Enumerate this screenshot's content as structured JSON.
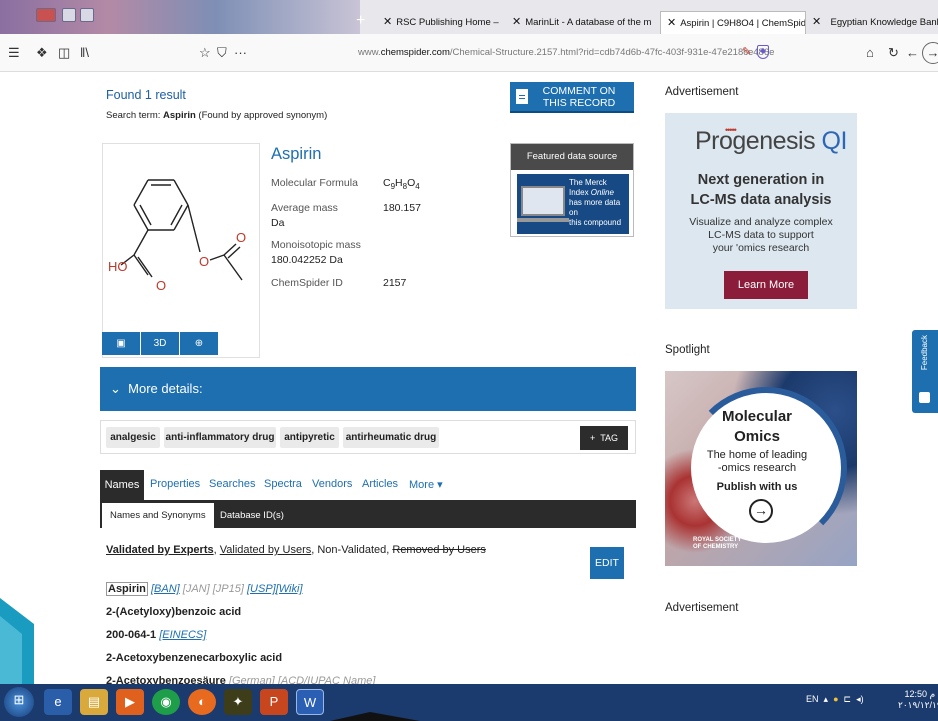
{
  "browser": {
    "tabs": [
      {
        "label": "RSC Publishing Home – Chem"
      },
      {
        "label": "MarinLit - A database of the m"
      },
      {
        "label": "Aspirin | C9H8O4 | ChemSpider"
      },
      {
        "label": "Egyptian Knowledge Bank"
      }
    ],
    "url_prefix": "www.",
    "url_domain": "chemspider.com",
    "url_rest": "/Chemical-Structure.2157.html?rid=cdb74d6b-47fc-403f-931e-47e218ce486e",
    "menu_icon": "☰",
    "more_icon": "···"
  },
  "results": {
    "found_text": "Found 1 result",
    "search_term_label": "Search term: ",
    "search_term_value": "Aspirin",
    "search_term_note": " (Found by approved synonym)"
  },
  "comment_button": {
    "line1": "COMMENT ON",
    "line2": "THIS RECORD"
  },
  "structure": {
    "atom_ho": "HO",
    "atom_o": "O",
    "btn_3d": "3D"
  },
  "compound": {
    "name": "Aspirin",
    "formula_label": "Molecular Formula",
    "formula_value": "C9H8O4",
    "avg_mass_label": "Average mass",
    "avg_mass_unit": "Da",
    "avg_mass_value": "180.157",
    "mono_mass_label": "Monoisotopic mass",
    "mono_mass_value": "180.042252 Da",
    "csid_label": "ChemSpider ID",
    "csid_value": "2157"
  },
  "featured": {
    "header": "Featured data source",
    "line1": "The Merck",
    "line2a": "Index ",
    "line2b": "Online",
    "line3": "has more data on",
    "line4": "this compound"
  },
  "more_details": {
    "label": "More details:",
    "chevron": "⌄"
  },
  "tags": [
    "analgesic",
    "anti-inflammatory drug",
    "antipyretic",
    "antirheumatic drug"
  ],
  "tag_button": {
    "plus": "+",
    "label": "TAG"
  },
  "tabs": [
    "Names",
    "Properties",
    "Searches",
    "Spectra",
    "Vendors",
    "Articles",
    "More"
  ],
  "more_caret": "▾",
  "subtabs": [
    "Names and Synonyms",
    "Database ID(s)"
  ],
  "validation": {
    "experts": "Validated by Experts",
    "sep1": ", ",
    "users": "Validated by Users",
    "sep2": ", Non-Validated, ",
    "removed": "Removed by Users"
  },
  "edit_button": "EDIT",
  "synonyms": [
    {
      "name": "Aspirin",
      "refs": [
        {
          "t": "[BAN]",
          "style": "ref"
        },
        {
          "t": "[JAN]",
          "style": "grey"
        },
        {
          "t": "[JP15]",
          "style": "grey"
        },
        {
          "t": "[USP]",
          "style": "ref"
        },
        {
          "t": "[Wiki]",
          "style": "ref"
        }
      ]
    },
    {
      "name": "2-(Acetyloxy)benzoic acid",
      "refs": []
    },
    {
      "name": "200-064-1",
      "refs": [
        {
          "t": "[EINECS]",
          "style": "ref"
        }
      ]
    },
    {
      "name": "2-Acetoxybenzenecarboxylic acid",
      "refs": []
    },
    {
      "name": "2-Acetoxybenzoesäure",
      "refs": [
        {
          "t": "[German]",
          "style": "grey"
        },
        {
          "t": "[ACD/IUPAC Name]",
          "style": "grey"
        }
      ]
    }
  ],
  "ads": {
    "advertisement_label": "Advertisement",
    "progenesis": {
      "logo_main": "Progenesis",
      "logo_qi": "QI",
      "dots": "•••••",
      "headline1": "Next generation in",
      "headline2": "LC-MS data analysis",
      "sub1": "Visualize and analyze complex",
      "sub2": "LC-MS data to support",
      "sub3": "your 'omics research",
      "button": "Learn More"
    },
    "spotlight_label": "Spotlight",
    "molecular_omics": {
      "title1": "Molecular",
      "title2": "Omics",
      "sub1": "The home of leading",
      "sub2": "-omics research",
      "cta": "Publish with us",
      "arrow": "→",
      "rsc1": "ROYAL SOCIETY",
      "rsc2": "OF CHEMISTRY"
    },
    "advertisement_label_2": "Advertisement"
  },
  "feedback": "Feedback",
  "taskbar": {
    "tray_lang": "EN",
    "clock_time": "12:50  م",
    "clock_date": "٢٠١٩/١٢/١٩"
  },
  "colors": {
    "chemspider_blue": "#1d6fb0",
    "dark_bar": "#2b2b2b",
    "taskbar": "#1b3a6e",
    "learn_more": "#8b1d3b"
  }
}
